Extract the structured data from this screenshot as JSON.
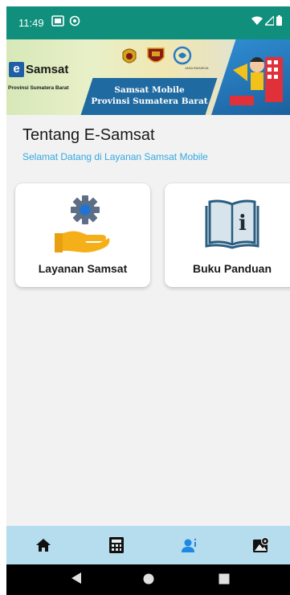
{
  "status_bar": {
    "time": "11:49",
    "left_icons": [
      "image-icon",
      "sync-icon"
    ],
    "right_icons": [
      "wifi-icon",
      "signal-icon",
      "battery-icon"
    ]
  },
  "banner": {
    "logo_e": "e",
    "logo_text": "Samsat",
    "province_caption": "Provinsi Sumatera Barat",
    "title_line1": "Samsat Mobile",
    "title_line2": "Provinsi Sumatera Barat",
    "emblem_caption": "JASA RAHARJA"
  },
  "header": {
    "title": "Tentang E-Samsat",
    "subtitle": "Selamat Datang di Layanan Samsat Mobile"
  },
  "cards": [
    {
      "label": "Layanan Samsat",
      "icon": "service-gear-hand-icon"
    },
    {
      "label": "Buku Panduan",
      "icon": "info-book-icon"
    }
  ],
  "bottom_nav": {
    "items": [
      {
        "icon": "home-icon"
      },
      {
        "icon": "calculator-icon"
      },
      {
        "icon": "user-info-icon",
        "active": true
      },
      {
        "icon": "map-icon"
      }
    ],
    "active_color": "#1e88e5"
  },
  "system_nav": [
    "back-icon",
    "home-circle-icon",
    "recents-icon"
  ],
  "colors": {
    "status_bar": "#0f8f7c",
    "subtitle": "#35a8e0",
    "bottom_nav_bg": "#b5dded"
  }
}
